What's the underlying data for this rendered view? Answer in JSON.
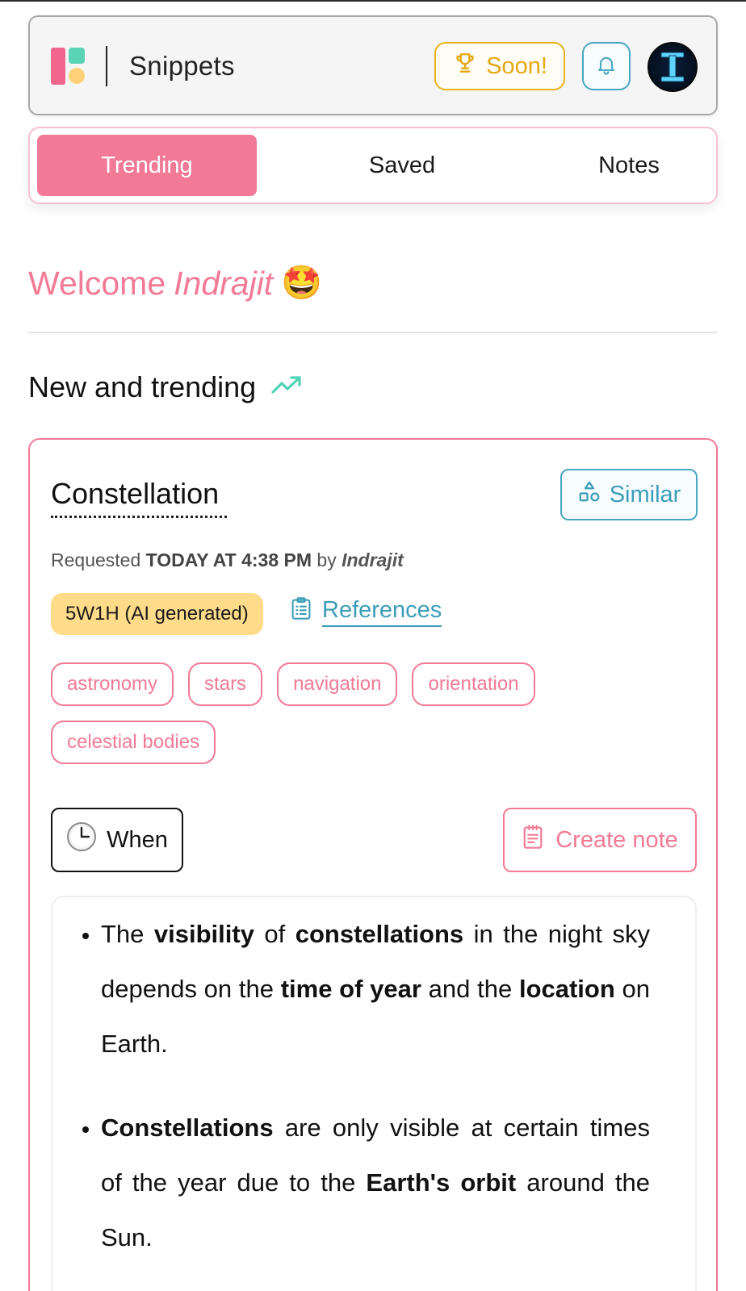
{
  "header": {
    "app_title": "Snippets",
    "soon_label": "Soon!",
    "avatar_letter": "I"
  },
  "tabs": [
    {
      "label": "Trending",
      "active": true
    },
    {
      "label": "Saved",
      "active": false
    },
    {
      "label": "Notes",
      "active": false
    }
  ],
  "welcome": {
    "prefix": "Welcome",
    "name": "Indrajit",
    "emoji": "🤩"
  },
  "section": {
    "title": "New and trending"
  },
  "card": {
    "title": "Constellation",
    "similar_label": "Similar",
    "meta": {
      "requested_label": "Requested",
      "when": "TODAY AT 4:38 PM",
      "by_label": "by",
      "user": "Indrajit"
    },
    "badge": "5W1H (AI generated)",
    "references_label": "References",
    "tags": [
      "astronomy",
      "stars",
      "navigation",
      "orientation",
      "celestial bodies"
    ],
    "when_label": "When",
    "create_note_label": "Create note",
    "bullets": [
      {
        "parts": [
          {
            "t": "The ",
            "b": false
          },
          {
            "t": "visibility",
            "b": true
          },
          {
            "t": " of ",
            "b": false
          },
          {
            "t": "constellations",
            "b": true
          },
          {
            "t": " in the night sky depends on the ",
            "b": false
          },
          {
            "t": "time of year",
            "b": true
          },
          {
            "t": " and the ",
            "b": false
          },
          {
            "t": "location",
            "b": true
          },
          {
            "t": " on Earth.",
            "b": false
          }
        ]
      },
      {
        "parts": [
          {
            "t": "Constellations",
            "b": true
          },
          {
            "t": " are only visible at certain times of the year due to the ",
            "b": false
          },
          {
            "t": "Earth's orbit",
            "b": true
          },
          {
            "t": " around the Sun.",
            "b": false
          }
        ]
      }
    ]
  },
  "colors": {
    "brand_pink": "#f27a96",
    "accent_teal": "#49a7c1",
    "gold": "#e8b31b",
    "badge_yellow": "#ffdb8a"
  }
}
